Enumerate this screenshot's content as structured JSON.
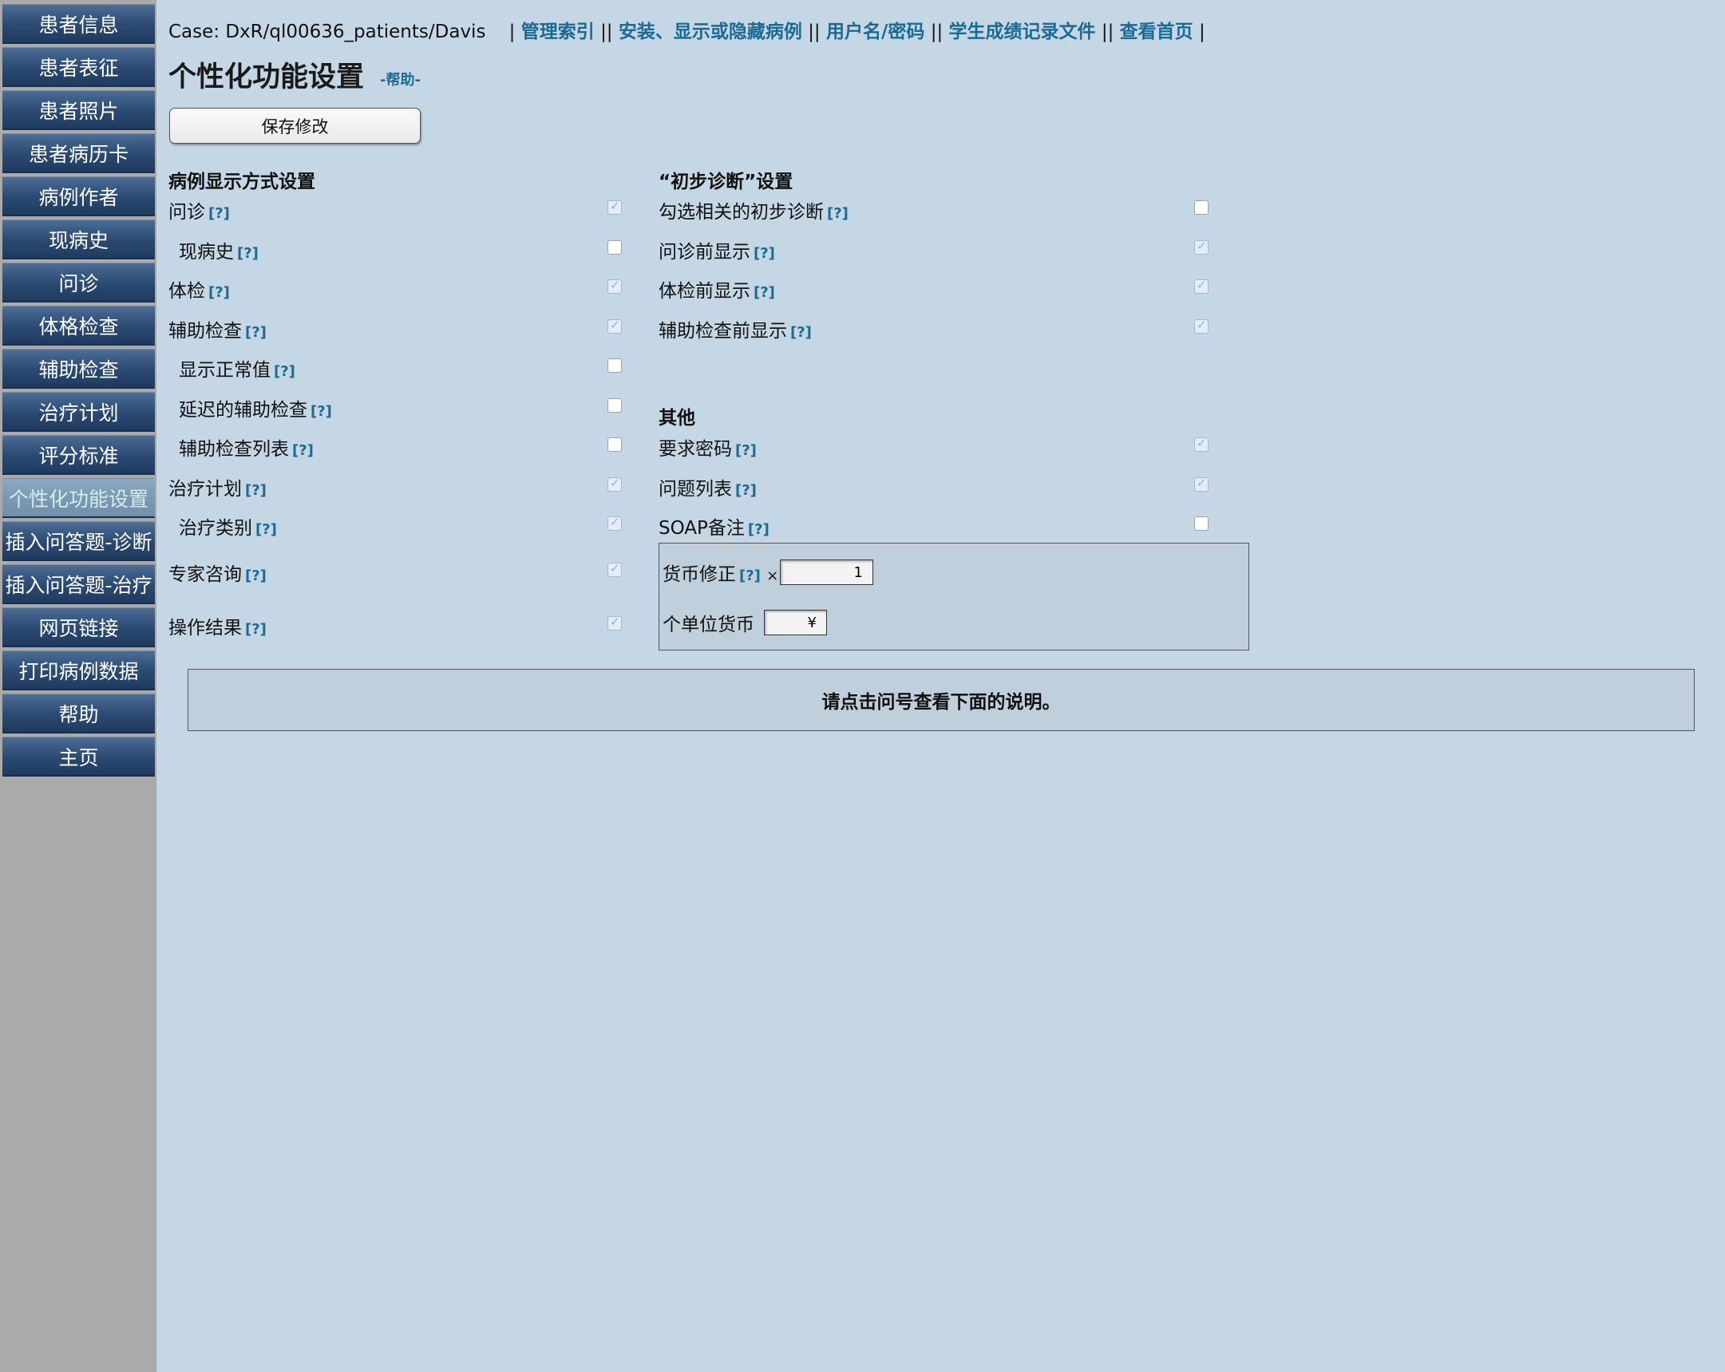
{
  "sidebar": {
    "items": [
      {
        "label": "患者信息"
      },
      {
        "label": "患者表征"
      },
      {
        "label": "患者照片"
      },
      {
        "label": "患者病历卡"
      },
      {
        "label": "病例作者"
      },
      {
        "label": "现病史"
      },
      {
        "label": "问诊"
      },
      {
        "label": "体格检查"
      },
      {
        "label": "辅助检查"
      },
      {
        "label": "治疗计划"
      },
      {
        "label": "评分标准"
      },
      {
        "label": "个性化功能设置",
        "active": true
      },
      {
        "label": "插入问答题-诊断"
      },
      {
        "label": "插入问答题-治疗"
      },
      {
        "label": "网页链接"
      },
      {
        "label": "打印病例数据"
      },
      {
        "label": "帮助"
      },
      {
        "label": "主页"
      }
    ]
  },
  "topbar": {
    "case": "Case: DxR/ql00636_patients/Davis",
    "links": [
      "管理索引",
      "安装、显示或隐藏病例",
      "用户名/密码",
      "学生成绩记录文件",
      "查看首页"
    ]
  },
  "page": {
    "title": "个性化功能设置",
    "help_link": "-帮助-",
    "save_button": "保存修改",
    "help_marker": "[?]"
  },
  "left_section": {
    "heading": "病例显示方式设置",
    "rows": [
      {
        "label": "问诊",
        "checked": true
      },
      {
        "label": "现病史",
        "checked": false
      },
      {
        "label": "体检",
        "checked": true
      },
      {
        "label": "辅助检查",
        "checked": true
      },
      {
        "label": "显示正常值",
        "checked": false
      },
      {
        "label": "延迟的辅助检查",
        "checked": false
      },
      {
        "label": "辅助检查列表",
        "checked": false
      },
      {
        "label": "治疗计划",
        "checked": true
      },
      {
        "label": "治疗类别",
        "checked": true
      },
      {
        "label": "专家咨询",
        "checked": true
      },
      {
        "label": "操作结果",
        "checked": true
      }
    ]
  },
  "diagnosis_section": {
    "heading": "“初步诊断”设置",
    "rows": [
      {
        "label": "勾选相关的初步诊断",
        "checked": false
      },
      {
        "label": "问诊前显示",
        "checked": true
      },
      {
        "label": "体检前显示",
        "checked": true
      },
      {
        "label": "辅助检查前显示",
        "checked": true
      }
    ]
  },
  "other_section": {
    "heading": "其他",
    "rows": [
      {
        "label": "要求密码",
        "checked": true
      },
      {
        "label": "问题列表",
        "checked": true
      },
      {
        "label": "SOAP备注",
        "checked": false
      }
    ]
  },
  "currency": {
    "correction_label": "货币修正",
    "multiply_sign": "×",
    "correction_value": "1",
    "unit_label": "个单位货币",
    "unit_value": "¥"
  },
  "info_panel": {
    "text": "请点击问号查看下面的说明。"
  }
}
